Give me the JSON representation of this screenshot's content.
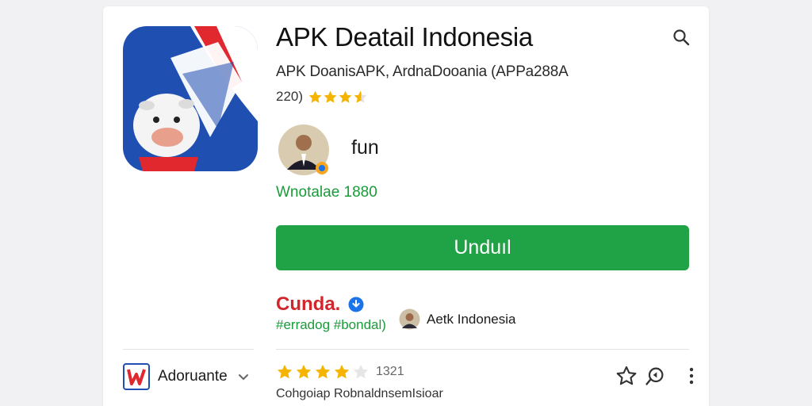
{
  "app": {
    "title": "APK Deatail Indonesia",
    "subtitle": "APK DoanisAPK, ArdnaDooania (APPa288A",
    "rating_text": "220)",
    "stars_filled": 3.5,
    "stars_total": 4,
    "developer_name": "fun",
    "downloads": "Wnotalae 1880",
    "install_label": "Unduıl",
    "brand_name": "Cunda.",
    "hashtag": "#erradog #bondal)",
    "publisher_name": "Aetk Indonesia",
    "category_label": "Adoruante",
    "review_stars": 4,
    "review_count": "1321",
    "review_text": "Cohgoiap RobnaldnsemIsioar"
  },
  "colors": {
    "install_button": "#1fa346",
    "brand": "#d0262c",
    "downloads": "#1a9b3a",
    "star": "#f4b400",
    "verified": "#1a73e8"
  },
  "icons": {
    "search": "search-icon",
    "star": "star-icon",
    "share": "share-icon",
    "more": "more-vert-icon",
    "verified": "verified-icon",
    "chevron": "chevron-down-icon"
  }
}
